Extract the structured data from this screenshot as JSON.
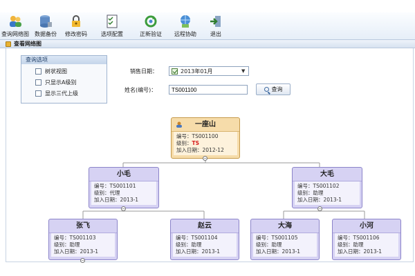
{
  "toolbar": {
    "items": [
      {
        "label": "查询网络图",
        "icon": "users-icon"
      },
      {
        "label": "数据备份",
        "icon": "database-icon"
      },
      {
        "label": "修改密码",
        "icon": "lock-icon"
      },
      {
        "label": "选项配置",
        "icon": "checklist-icon"
      },
      {
        "label": "正新验证",
        "icon": "refresh-icon"
      },
      {
        "label": "远程协助",
        "icon": "remote-icon"
      },
      {
        "label": "退出",
        "icon": "exit-icon"
      }
    ]
  },
  "panel_title": "查看网络图",
  "options": {
    "title": "查询选项",
    "items": [
      "树状视图",
      "只显示A级别",
      "显示三代上级"
    ]
  },
  "form": {
    "date_label": "销售日期：",
    "date_value": "2013年01月",
    "name_label": "姓名(编号)：",
    "name_value": "TS001100",
    "query_button": "查询"
  },
  "tree": {
    "root": {
      "name": "一座山",
      "id_line": "编号：TS001100",
      "level_label": "级别：",
      "level_value": "TS",
      "join_line": "加入日期：2012-12"
    },
    "level1": [
      {
        "name": "小毛",
        "id_line": "编号：TS001101",
        "level_line": "级别：代理",
        "join_line": "加入日期：2013-1"
      },
      {
        "name": "大毛",
        "id_line": "编号：TS001102",
        "level_line": "级别：助理",
        "join_line": "加入日期：2013-1"
      }
    ],
    "level2": [
      {
        "name": "张飞",
        "id_line": "编号：TS001103",
        "level_line": "级别：助理",
        "join_line": "加入日期：2013-1"
      },
      {
        "name": "赵云",
        "id_line": "编号：TS001104",
        "level_line": "级别：助理",
        "join_line": "加入日期：2013-1"
      },
      {
        "name": "大海",
        "id_line": "编号：TS001105",
        "level_line": "级别：助理",
        "join_line": "加入日期：2013-1"
      },
      {
        "name": "小河",
        "id_line": "编号：TS001106",
        "level_line": "级别：助理",
        "join_line": "加入日期：2013-1"
      }
    ]
  }
}
